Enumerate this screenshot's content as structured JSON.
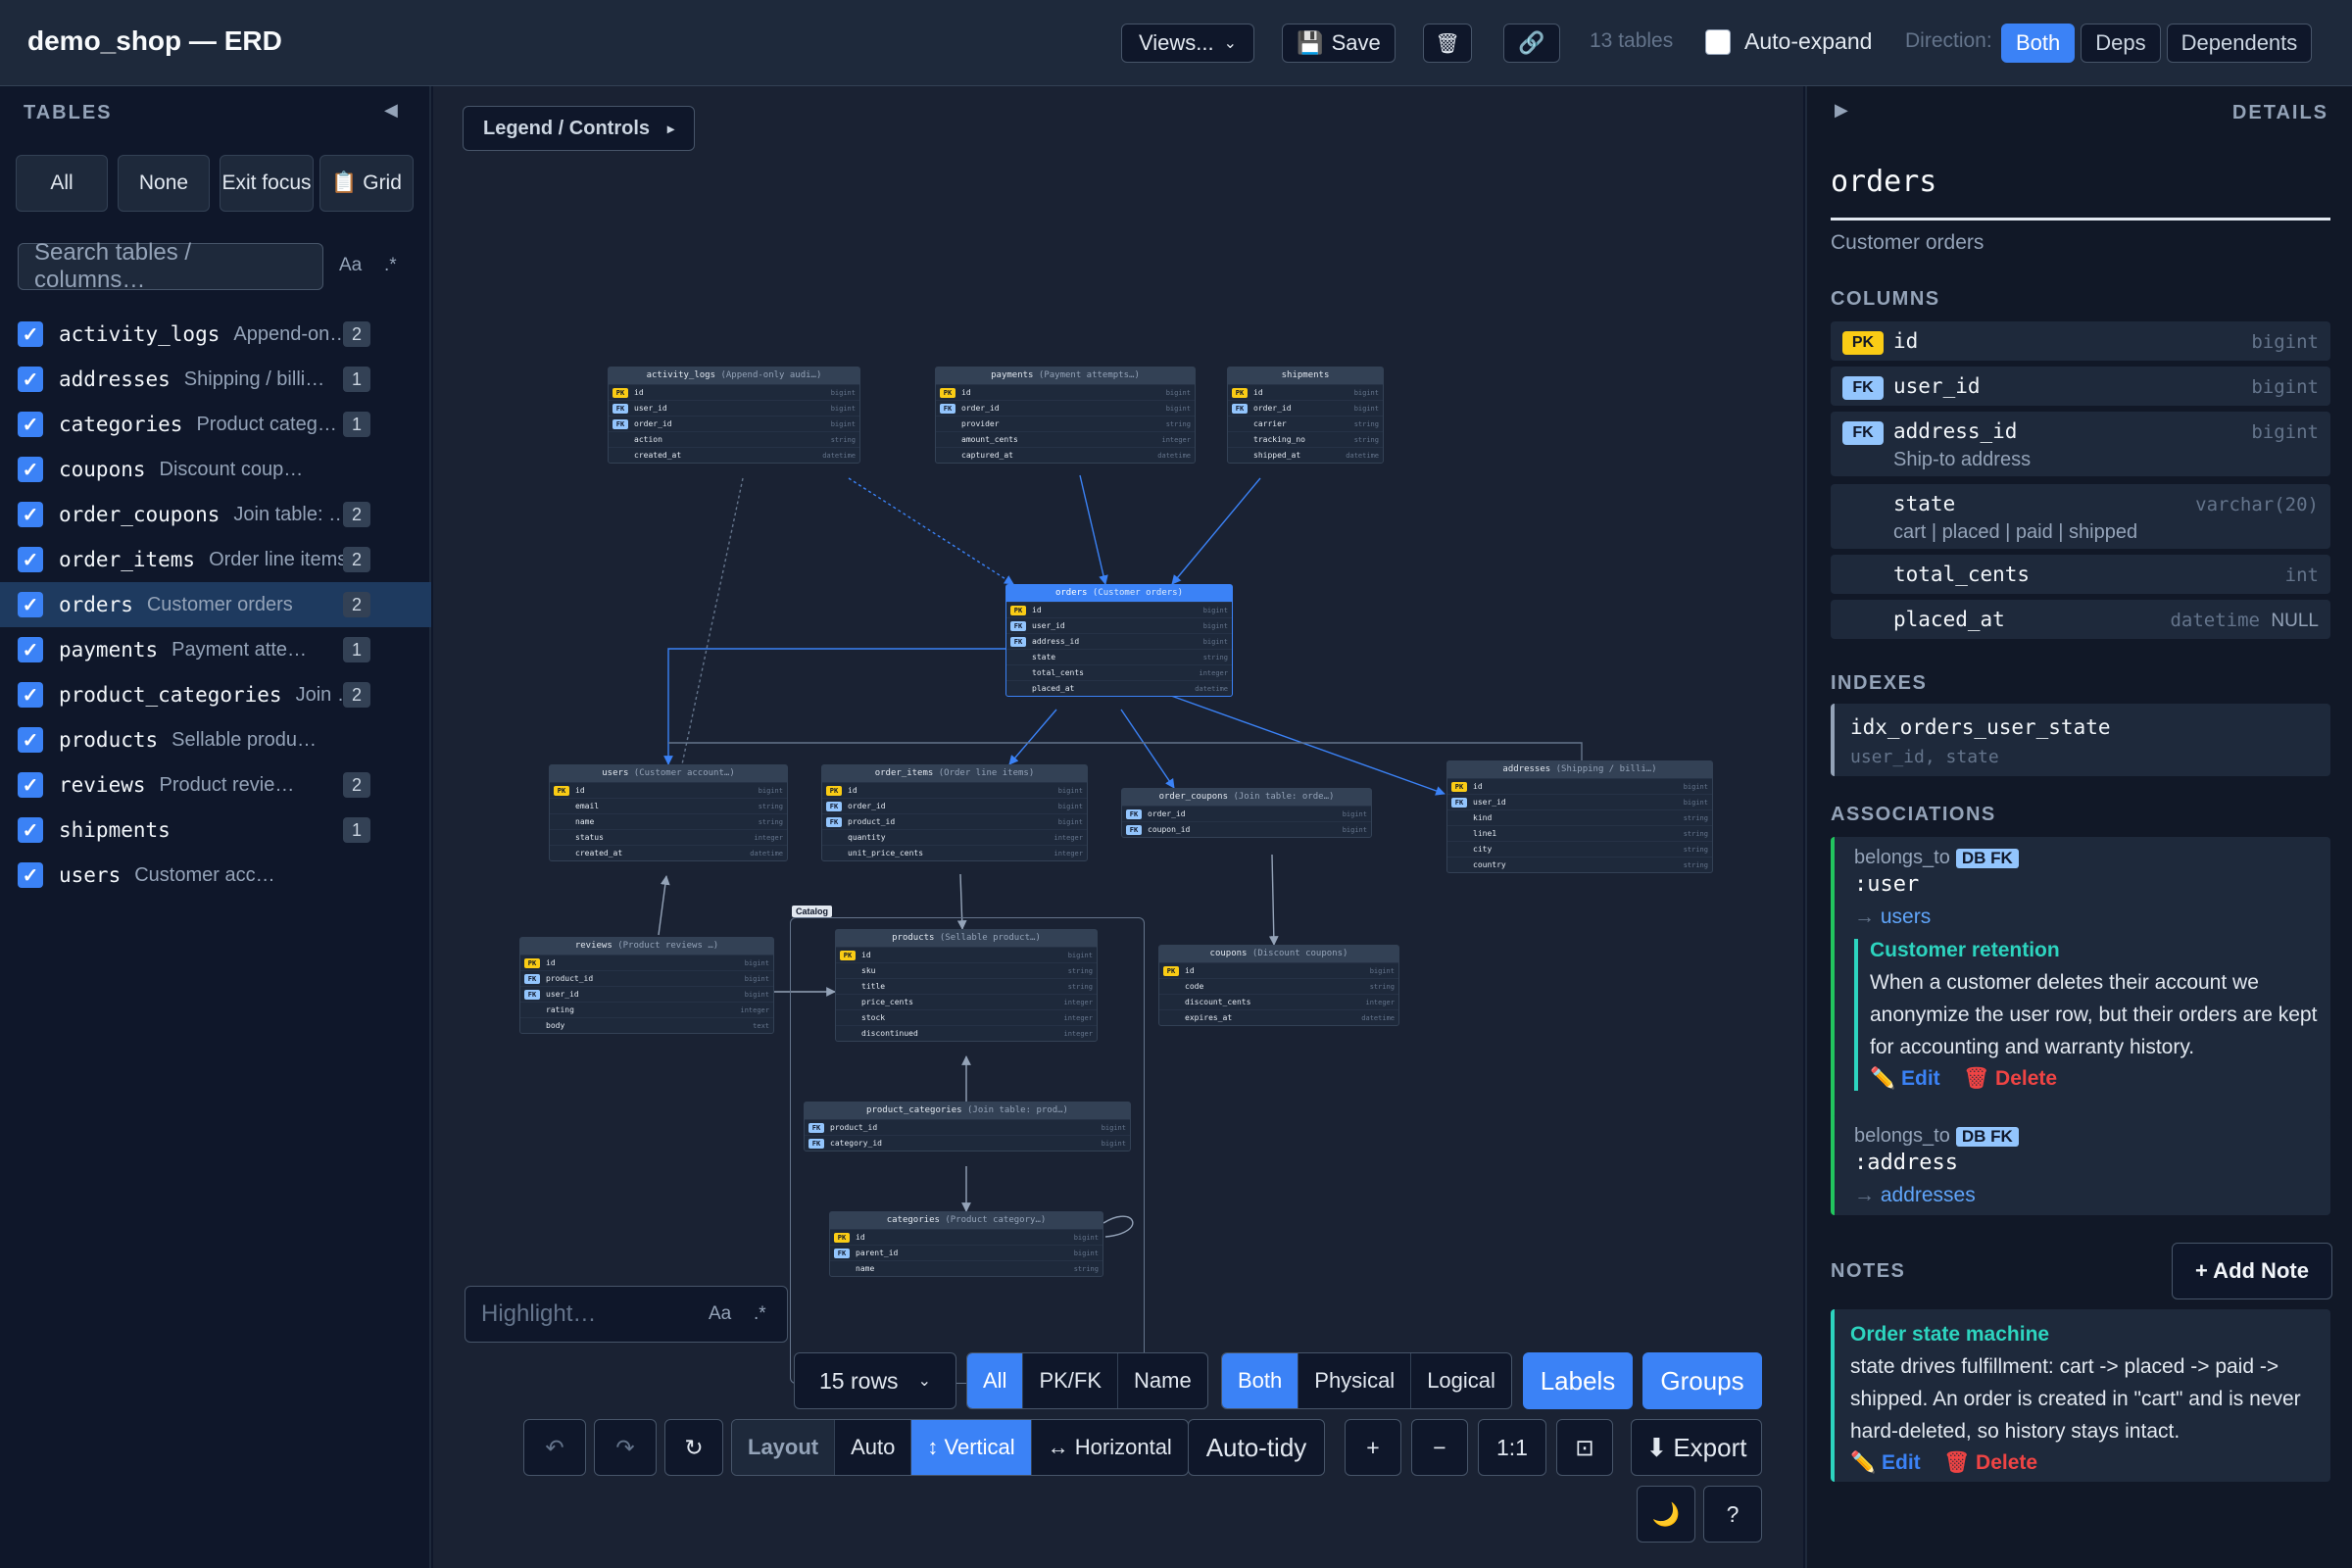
{
  "header": {
    "title": "demo_shop — ERD",
    "views_label": "Views...",
    "save_label": "Save",
    "tables_count": "13 tables",
    "auto_expand_label": "Auto-expand",
    "direction_label": "Direction:",
    "direction_options": [
      "Both",
      "Deps",
      "Dependents"
    ]
  },
  "sidebar": {
    "title": "TABLES",
    "buttons": [
      "All",
      "None",
      "Exit focus",
      "Grid"
    ],
    "search_placeholder": "Search tables / columns…",
    "search_case": "Aa",
    "search_regex": ".*",
    "tables": [
      {
        "name": "activity_logs",
        "desc": "Append-on…",
        "count": "2"
      },
      {
        "name": "addresses",
        "desc": "Shipping / billi…",
        "count": "1"
      },
      {
        "name": "categories",
        "desc": "Product categ…",
        "count": "1"
      },
      {
        "name": "coupons",
        "desc": "Discount coupons",
        "count": ""
      },
      {
        "name": "order_coupons",
        "desc": "Join table: …",
        "count": "2"
      },
      {
        "name": "order_items",
        "desc": "Order line items",
        "count": "2"
      },
      {
        "name": "orders",
        "desc": "Customer orders",
        "count": "2"
      },
      {
        "name": "payments",
        "desc": "Payment attempt…",
        "count": "1"
      },
      {
        "name": "product_categories",
        "desc": "Join …",
        "count": "2"
      },
      {
        "name": "products",
        "desc": "Sellable product…",
        "count": ""
      },
      {
        "name": "reviews",
        "desc": "Product reviews …",
        "count": "2"
      },
      {
        "name": "shipments",
        "desc": "",
        "count": "1"
      },
      {
        "name": "users",
        "desc": "Customer account…",
        "count": ""
      }
    ]
  },
  "canvas": {
    "legend_label": "Legend / Controls",
    "group_label": "Catalog",
    "entities": {
      "activity_logs": {
        "title": "activity_logs",
        "desc": "(Append-only audi…)",
        "rows": [
          [
            "PK",
            "id",
            "bigint"
          ],
          [
            "FK",
            "user_id",
            "bigint"
          ],
          [
            "FK",
            "order_id",
            "bigint"
          ],
          [
            "",
            "action",
            "string"
          ],
          [
            "",
            "created_at",
            "datetime"
          ]
        ]
      },
      "payments": {
        "title": "payments",
        "desc": "(Payment attempts…)",
        "rows": [
          [
            "PK",
            "id",
            "bigint"
          ],
          [
            "FK",
            "order_id",
            "bigint"
          ],
          [
            "",
            "provider",
            "string"
          ],
          [
            "",
            "amount_cents",
            "integer"
          ],
          [
            "",
            "captured_at",
            "datetime"
          ]
        ]
      },
      "shipments": {
        "title": "shipments",
        "desc": "",
        "rows": [
          [
            "PK",
            "id",
            "bigint"
          ],
          [
            "FK",
            "order_id",
            "bigint"
          ],
          [
            "",
            "carrier",
            "string"
          ],
          [
            "",
            "tracking_no",
            "string"
          ],
          [
            "",
            "shipped_at",
            "datetime"
          ]
        ]
      },
      "orders": {
        "title": "orders",
        "desc": "(Customer orders)",
        "rows": [
          [
            "PK",
            "id",
            "bigint"
          ],
          [
            "FK",
            "user_id",
            "bigint"
          ],
          [
            "FK",
            "address_id",
            "bigint"
          ],
          [
            "",
            "state",
            "string"
          ],
          [
            "",
            "total_cents",
            "integer"
          ],
          [
            "",
            "placed_at",
            "datetime"
          ]
        ]
      },
      "users": {
        "title": "users",
        "desc": "(Customer account…)",
        "rows": [
          [
            "PK",
            "id",
            "bigint"
          ],
          [
            "",
            "email",
            "string"
          ],
          [
            "",
            "name",
            "string"
          ],
          [
            "",
            "status",
            "integer"
          ],
          [
            "",
            "created_at",
            "datetime"
          ]
        ]
      },
      "order_items": {
        "title": "order_items",
        "desc": "(Order line items)",
        "rows": [
          [
            "PK",
            "id",
            "bigint"
          ],
          [
            "FK",
            "order_id",
            "bigint"
          ],
          [
            "FK",
            "product_id",
            "bigint"
          ],
          [
            "",
            "quantity",
            "integer"
          ],
          [
            "",
            "unit_price_cents",
            "integer"
          ]
        ]
      },
      "order_coupons": {
        "title": "order_coupons",
        "desc": "(Join table: orde…)",
        "rows": [
          [
            "FK",
            "order_id",
            "bigint"
          ],
          [
            "FK",
            "coupon_id",
            "bigint"
          ]
        ]
      },
      "addresses": {
        "title": "addresses",
        "desc": "(Shipping / billi…)",
        "rows": [
          [
            "PK",
            "id",
            "bigint"
          ],
          [
            "FK",
            "user_id",
            "bigint"
          ],
          [
            "",
            "kind",
            "string"
          ],
          [
            "",
            "line1",
            "string"
          ],
          [
            "",
            "city",
            "string"
          ],
          [
            "",
            "country",
            "string"
          ]
        ]
      },
      "reviews": {
        "title": "reviews",
        "desc": "(Product reviews …)",
        "rows": [
          [
            "PK",
            "id",
            "bigint"
          ],
          [
            "FK",
            "product_id",
            "bigint"
          ],
          [
            "FK",
            "user_id",
            "bigint"
          ],
          [
            "",
            "rating",
            "integer"
          ],
          [
            "",
            "body",
            "text"
          ]
        ]
      },
      "products": {
        "title": "products",
        "desc": "(Sellable product…)",
        "rows": [
          [
            "PK",
            "id",
            "bigint"
          ],
          [
            "",
            "sku",
            "string"
          ],
          [
            "",
            "title",
            "string"
          ],
          [
            "",
            "price_cents",
            "integer"
          ],
          [
            "",
            "stock",
            "integer"
          ],
          [
            "",
            "discontinued",
            "integer"
          ]
        ]
      },
      "coupons": {
        "title": "coupons",
        "desc": "(Discount coupons)",
        "rows": [
          [
            "PK",
            "id",
            "bigint"
          ],
          [
            "",
            "code",
            "string"
          ],
          [
            "",
            "discount_cents",
            "integer"
          ],
          [
            "",
            "expires_at",
            "datetime"
          ]
        ]
      },
      "product_categories": {
        "title": "product_categories",
        "desc": "(Join table: prod…)",
        "rows": [
          [
            "FK",
            "product_id",
            "bigint"
          ],
          [
            "FK",
            "category_id",
            "bigint"
          ]
        ]
      },
      "categories": {
        "title": "categories",
        "desc": "(Product category…)",
        "rows": [
          [
            "PK",
            "id",
            "bigint"
          ],
          [
            "FK",
            "parent_id",
            "bigint"
          ],
          [
            "",
            "name",
            "string"
          ]
        ]
      }
    },
    "highlight_placeholder": "Highlight…",
    "highlight_case": "Aa",
    "highlight_regex": ".*"
  },
  "toolbar": {
    "rows_value": "15 rows",
    "filter_options": [
      "All",
      "PK/FK",
      "Name"
    ],
    "model_options": [
      "Both",
      "Physical",
      "Logical"
    ],
    "labels": "Labels",
    "groups": "Groups",
    "layout_label": "Layout",
    "layout_options": [
      "Auto",
      "↕ Vertical",
      "↔ Horizontal"
    ],
    "auto_tidy": "Auto-tidy",
    "zoom_in": "+",
    "zoom_out": "−",
    "zoom_reset": "1:1",
    "fit": "⊡",
    "export": "Export",
    "help": "?"
  },
  "details": {
    "title": "DETAILS",
    "entity": "orders",
    "desc": "Customer orders",
    "columns_title": "COLUMNS",
    "columns": [
      {
        "key": "PK",
        "name": "id",
        "type": "bigint",
        "desc": "",
        "null": ""
      },
      {
        "key": "FK",
        "name": "user_id",
        "type": "bigint",
        "desc": "",
        "null": ""
      },
      {
        "key": "FK",
        "name": "address_id",
        "type": "bigint",
        "desc": "Ship-to address",
        "null": ""
      },
      {
        "key": "",
        "name": "state",
        "type": "varchar(20)",
        "desc": "cart | placed | paid | shipped",
        "null": ""
      },
      {
        "key": "",
        "name": "total_cents",
        "type": "int",
        "desc": "",
        "null": ""
      },
      {
        "key": "",
        "name": "placed_at",
        "type": "datetime",
        "desc": "",
        "null": "NULL"
      }
    ],
    "indexes_title": "INDEXES",
    "index_name": "idx_orders_user_state",
    "index_cols": "user_id, state",
    "assoc_title": "ASSOCIATIONS",
    "associations": [
      {
        "kind": "belongs_to",
        "badge": "DB FK",
        "name": ":user",
        "target": "users",
        "note_title": "Customer retention",
        "note_body": "When a customer deletes their account we anonymize the user row, but their orders are kept for accounting and warranty history.",
        "edit": "Edit",
        "delete": "Delete"
      },
      {
        "kind": "belongs_to",
        "badge": "DB FK",
        "name": ":address",
        "target": "addresses"
      }
    ],
    "notes_title": "NOTES",
    "add_note": "+ Add Note",
    "note": {
      "title": "Order state machine",
      "body": "state drives fulfillment: cart -> placed -> paid -> shipped. An order is created in \"cart\" and is never hard-deleted, so history stays intact.",
      "edit": "Edit",
      "delete": "Delete"
    }
  }
}
